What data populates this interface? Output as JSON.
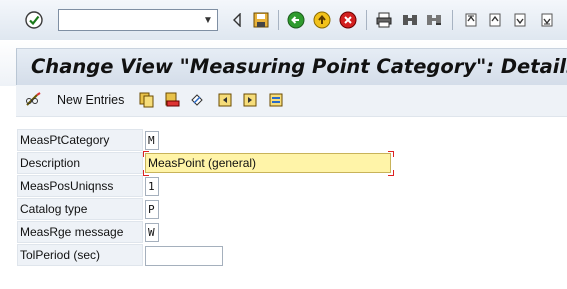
{
  "toolbar": {
    "command_field": {
      "value": ""
    },
    "icons": {
      "enter": "check-icon",
      "back_nav": "triangle-left-icon",
      "save": "save-icon",
      "back": "green-back-icon",
      "exit": "yellow-exit-icon",
      "cancel": "red-cancel-icon",
      "print": "print-icon",
      "find": "find-icon",
      "find_next": "find-next-icon",
      "first_page": "first-page-icon",
      "prev_page": "prev-page-icon",
      "next_page": "next-page-icon",
      "last_page": "last-page-icon"
    }
  },
  "title": "Change View \"Measuring Point Category\": Details",
  "app_toolbar": {
    "new_entries_label": "New Entries",
    "icons": [
      "glasses-edit-icon",
      "copy-icon",
      "delete-icon",
      "undo-icon",
      "prev-entry-icon",
      "next-entry-icon",
      "select-all-icon"
    ]
  },
  "form": {
    "meas_pt_category": {
      "label": "MeasPtCategory",
      "value": "M"
    },
    "description": {
      "label": "Description",
      "value": "MeasPoint (general)"
    },
    "meas_pos_uniqnss": {
      "label": "MeasPosUniqnss",
      "value": "1"
    },
    "catalog_type": {
      "label": "Catalog type",
      "value": "P"
    },
    "meas_rge_message": {
      "label": "MeasRge message",
      "value": "W"
    },
    "tol_period": {
      "label": "TolPeriod (sec)",
      "value": ""
    }
  },
  "colors": {
    "toolbar_bg": "#dfe7f0",
    "title_panel_bg": "#d4dde9",
    "active_field_bg": "#fff4a8",
    "label_bg": "#eef2f7"
  }
}
